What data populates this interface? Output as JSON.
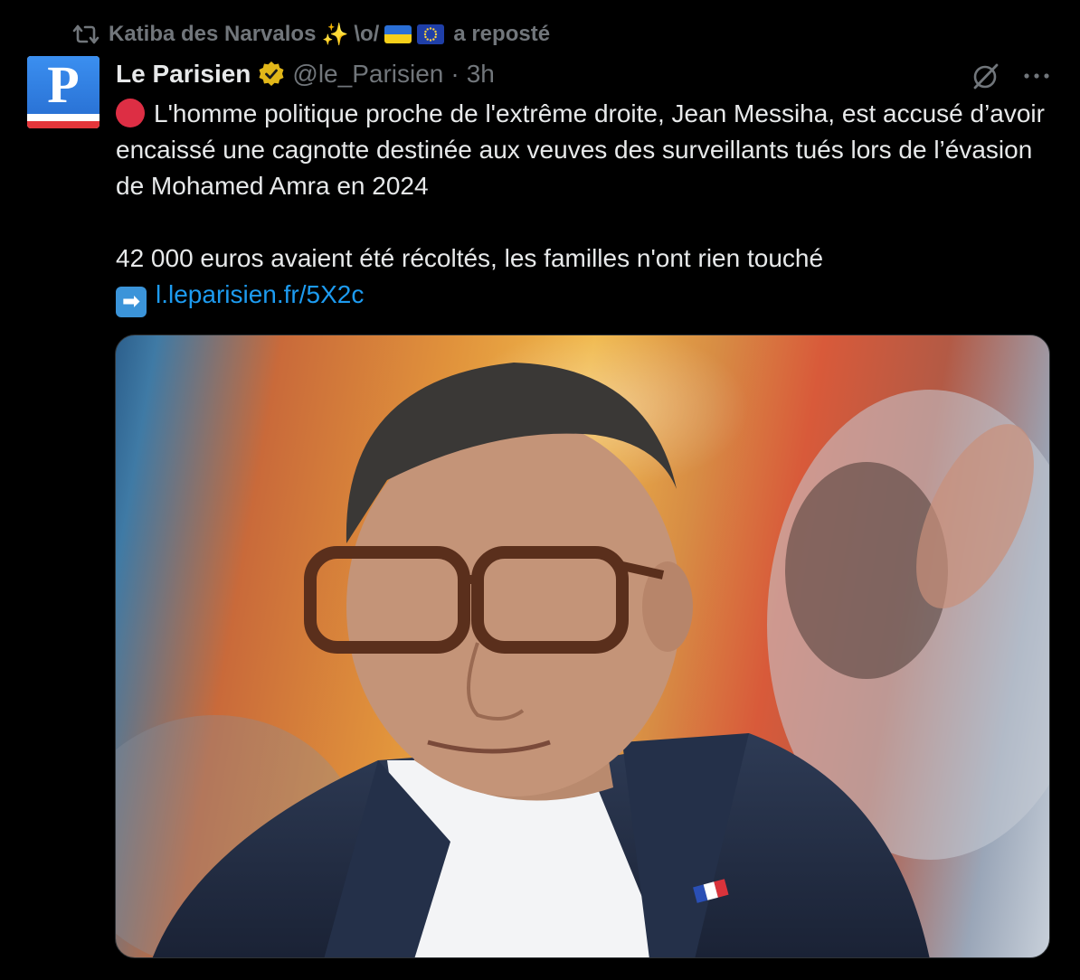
{
  "repost": {
    "user": "Katiba des Narvalos",
    "sparkle": "✨",
    "emote": "\\o/",
    "suffix": "a reposté"
  },
  "account": {
    "avatar_letter": "P",
    "name": "Le Parisien",
    "handle": "@le_Parisien",
    "separator": "·",
    "time": "3h"
  },
  "tweet": {
    "line1": "L'homme politique proche de l'extrême droite, Jean Messiha, est accusé d’avoir encaissé une cagnotte destinée aux veuves des surveillants tués lors de l’évasion de Mohamed Amra en 2024",
    "line2": "42 000 euros avaient été récoltés, les familles n'ont rien touché",
    "arrow": "➡",
    "link": "l.leparisien.fr/5X2c"
  },
  "colors": {
    "background": "#000000",
    "text": "#e7e9ea",
    "muted": "#71767b",
    "link": "#1d9bf0",
    "badge": "#e2b719",
    "red_dot": "#dd2e44"
  }
}
